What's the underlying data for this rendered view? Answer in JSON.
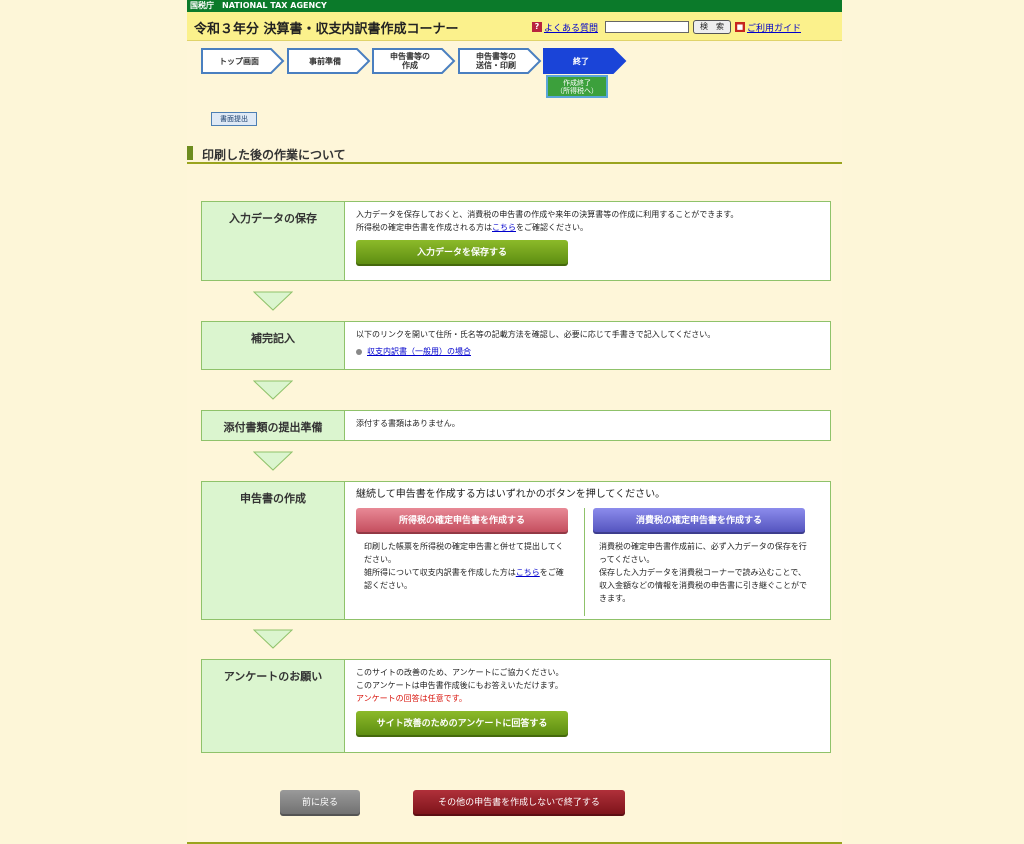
{
  "header": {
    "agency": "国税庁　NATIONAL TAX AGENCY",
    "title": "令和３年分 決算書・収支内訳書作成コーナー",
    "faq_label": "よくある質問",
    "search_label": "検　索",
    "guide_label": "ご利用ガイド"
  },
  "steps": [
    {
      "label": "トップ画面"
    },
    {
      "label": "事前準備"
    },
    {
      "label": "申告書等の\n作成"
    },
    {
      "label": "申告書等の\n送信・印刷"
    },
    {
      "label": "終了"
    }
  ],
  "sub_step": "作成終了\n（所得税へ）",
  "doc_button": "書面提出",
  "section_title": "印刷した後の作業について",
  "boxes": {
    "save": {
      "title": "入力データの保存",
      "line1": "入力データを保存しておくと、消費税の申告書の作成や来年の決算書等の作成に利用することができます。",
      "line2_pre": "所得税の確定申告書を作成される方は",
      "line2_link": "こちら",
      "line2_post": "をご確認ください。",
      "button": "入力データを保存する"
    },
    "supplement": {
      "title": "補完記入",
      "line1": "以下のリンクを開いて住所・氏名等の記載方法を確認し、必要に応じて手書きで記入してください。",
      "link": "収支内訳書（一般用）の場合"
    },
    "attach": {
      "title": "添付書類の提出準備",
      "line1": "添付する書類はありません。"
    },
    "create": {
      "title": "申告書の作成",
      "lead": "継続して申告書を作成する方はいずれかのボタンを押してください。",
      "income_button": "所得税の確定申告書を作成する",
      "consumption_button": "消費税の確定申告書を作成する",
      "income_text1": "印刷した帳票を所得税の確定申告書と併せて提出してください。",
      "income_text2_pre": "雑所得について収支内訳書を作成した方は",
      "income_text2_link": "こちら",
      "income_text2_post": "をご確認ください。",
      "consumption_text1": "消費税の確定申告書作成前に、必ず入力データの保存を行ってください。",
      "consumption_text2": "保存した入力データを消費税コーナーで読み込むことで、収入金額などの情報を消費税の申告書に引き継ぐことができます。"
    },
    "survey": {
      "title": "アンケートのお願い",
      "line1": "このサイトの改善のため、アンケートにご協力ください。",
      "line2": "このアンケートは申告書作成後にもお答えいただけます。",
      "line3": "アンケートの回答は任意です。",
      "button": "サイト改善のためのアンケートに回答する"
    }
  },
  "footer": {
    "back_label": "前に戻る",
    "finish_label": "その他の申告書を作成しないで終了する"
  },
  "colors": {
    "background": "#fdf6d8",
    "title_bar": "#fbf18c",
    "agency_bar": "#0b7a2a",
    "box_left": "#dbf5cf",
    "border": "#8fc26a",
    "active_step": "#1a44d8"
  }
}
